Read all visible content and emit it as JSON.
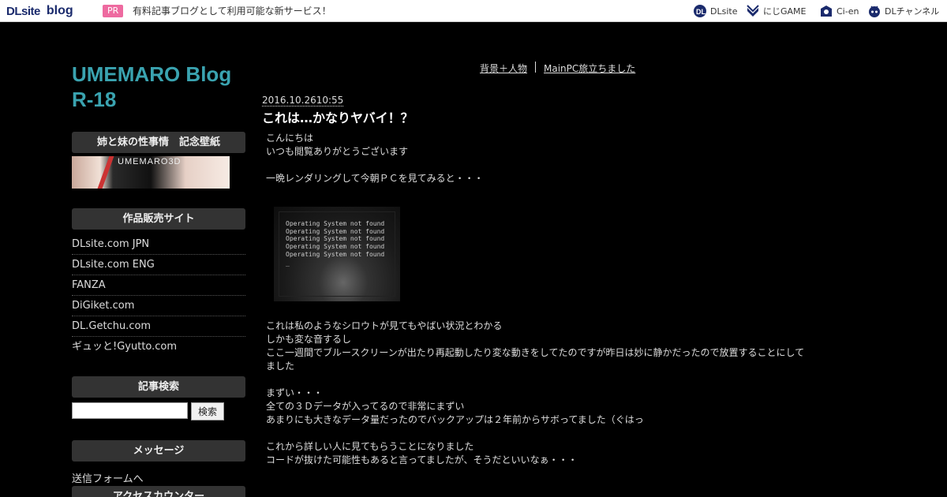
{
  "topbar": {
    "logo_dl": "DLsite",
    "logo_blog": "blog",
    "pr_badge": "PR",
    "pr_text": "有料記事ブログとして利用可能な新サービス！",
    "services": [
      {
        "label": "DLsite",
        "icon": "dlsite-icon"
      },
      {
        "label": "にじGAME",
        "icon": "nijigame-icon"
      },
      {
        "label": "Ci-en",
        "icon": "cien-icon"
      },
      {
        "label": "DLチャンネル",
        "icon": "dlchannel-icon"
      }
    ]
  },
  "sidebar": {
    "blog_title": "UMEMARO Blog R-18",
    "sections": [
      {
        "heading": "姉と妹の性事情　記念壁紙"
      },
      {
        "heading": "作品販売サイト"
      },
      {
        "heading": "記事検索"
      },
      {
        "heading": "メッセージ"
      },
      {
        "heading": "アクセスカウンター"
      }
    ],
    "banner_text": "UMEMARO3D",
    "links": [
      "DLsite.com JPN",
      "DLsite.com ENG",
      "FANZA",
      "DiGiket.com",
      "DL.Getchu.com",
      "ギュッと!Gyutto.com"
    ],
    "search_button": "検索",
    "search_value": "",
    "message_link": "送信フォームへ"
  },
  "main": {
    "nav_prev": "背景＋人物",
    "nav_next": "MainPC旅立ちました",
    "post_date": "2016.10.2610:55",
    "post_title": "これは…かなりヤバイ！？",
    "para1": "こんにちは\nいつも閲覧ありがとうございます\n\n一晩レンダリングして今朝ＰＣを見てみると・・・",
    "photo_lines": [
      "Operating System not found",
      "Operating System not found",
      "Operating System not found",
      "Operating System not found",
      "Operating System not found",
      "_"
    ],
    "para2": "これは私のようなシロウトが見てもやばい状況とわかる\nしかも変な音するし\nここ一週間でブルースクリーンが出たり再起動したり変な動きをしてたのですが昨日は妙に静かだったので放置することにしてました\n\nまずい・・・\n全ての３Ｄデータが入ってるので非常にまずい\nあまりにも大きなデータ量だったのでバックアップは２年前からサボってました（ぐはっ\n\nこれから詳しい人に見てもらうことになりました\nコードが抜けた可能性もあると言ってましたが、そうだといいなぁ・・・"
  },
  "colors": {
    "background": "#000000",
    "title_accent": "#3aa3b0",
    "pr_badge": "#ee6aa0",
    "sidebar_heading_bg": "#333333",
    "logo": "#1a2a6c"
  }
}
